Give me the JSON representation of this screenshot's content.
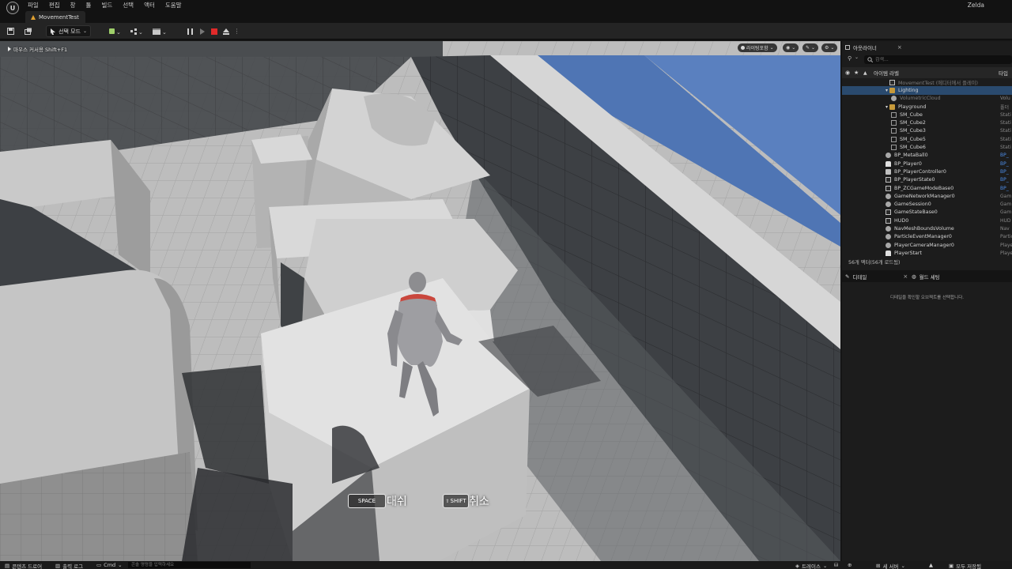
{
  "app": {
    "logo_letter": "U",
    "menu": [
      "파일",
      "편집",
      "창",
      "툴",
      "빌드",
      "선택",
      "액터",
      "도움말"
    ],
    "user": "Zelda",
    "level_tab": "MovementTest"
  },
  "toolbar": {
    "mode_label": "선택 모드"
  },
  "viewport": {
    "hint": "마우스 커서용 Shift+F1",
    "lighting_label": "라이팅포함",
    "hud": {
      "dash_key": "SPACE",
      "dash_label": "대쉬",
      "cancel_key": "SHIFT",
      "cancel_label": "취소"
    }
  },
  "outliner": {
    "tab_label": "아웃라이너",
    "search_placeholder": "검색...",
    "col_label": "아이템 라벨",
    "col_type": "타입",
    "rows": [
      {
        "label": "MovementTest (에디터에서 플레이)",
        "type": "",
        "indent": 0,
        "icon": "level",
        "dim": true
      },
      {
        "label": "Lighting",
        "type": "",
        "indent": 1,
        "icon": "folder",
        "selected": true
      },
      {
        "label": "VolumetricCloud",
        "type": "Volu",
        "indent": 2,
        "icon": "actor",
        "dim": true
      },
      {
        "label": "Playground",
        "type": "폴더",
        "indent": 1,
        "icon": "folder"
      },
      {
        "label": "SM_Cube",
        "type": "Stati",
        "indent": 2,
        "icon": "mesh"
      },
      {
        "label": "SM_Cube2",
        "type": "Stati",
        "indent": 2,
        "icon": "mesh"
      },
      {
        "label": "SM_Cube3",
        "type": "Stati",
        "indent": 2,
        "icon": "mesh"
      },
      {
        "label": "SM_Cube5",
        "type": "Stati",
        "indent": 2,
        "icon": "mesh"
      },
      {
        "label": "SM_Cube6",
        "type": "Stati",
        "indent": 2,
        "icon": "mesh"
      },
      {
        "label": "BP_MetaBall0",
        "type": "BP_",
        "indent": 0,
        "icon": "actor",
        "link": true
      },
      {
        "label": "BP_Player0",
        "type": "BP_",
        "indent": 0,
        "icon": "pawn",
        "link": true
      },
      {
        "label": "BP_PlayerController0",
        "type": "BP_",
        "indent": 0,
        "icon": "ctrl",
        "link": true
      },
      {
        "label": "BP_PlayerState0",
        "type": "BP_",
        "indent": 0,
        "icon": "box",
        "link": true
      },
      {
        "label": "BP_ZCGameModeBase0",
        "type": "BP_",
        "indent": 0,
        "icon": "box",
        "link": true
      },
      {
        "label": "GameNetworkManager0",
        "type": "Gam",
        "indent": 0,
        "icon": "actor"
      },
      {
        "label": "GameSession0",
        "type": "Gam",
        "indent": 0,
        "icon": "actor"
      },
      {
        "label": "GameStateBase0",
        "type": "Gam",
        "indent": 0,
        "icon": "box"
      },
      {
        "label": "HUD0",
        "type": "HUD",
        "indent": 0,
        "icon": "box"
      },
      {
        "label": "NavMeshBoundsVolume",
        "type": "Nav",
        "indent": 0,
        "icon": "actor"
      },
      {
        "label": "ParticleEventManager0",
        "type": "Partic",
        "indent": 0,
        "icon": "actor"
      },
      {
        "label": "PlayerCameraManager0",
        "type": "Playe",
        "indent": 0,
        "icon": "actor"
      },
      {
        "label": "PlayerStart",
        "type": "Playe",
        "indent": 0,
        "icon": "pawn"
      }
    ],
    "count": "56개 액터(56개 로드됨)"
  },
  "details": {
    "tab_label": "디테일",
    "world_tab_label": "월드 세팅",
    "empty_msg": "디테일을 확인할 오브젝트를 선택합니다."
  },
  "statusbar": {
    "content_drawer": "콘텐츠 드로어",
    "output_log": "출력 로그",
    "cmd": "Cmd",
    "cmd_placeholder": "콘솔 명령을 입력하세요",
    "trace": "트레이스",
    "derived": "",
    "net": "세 서버",
    "save_all": "모두 저장됨"
  }
}
